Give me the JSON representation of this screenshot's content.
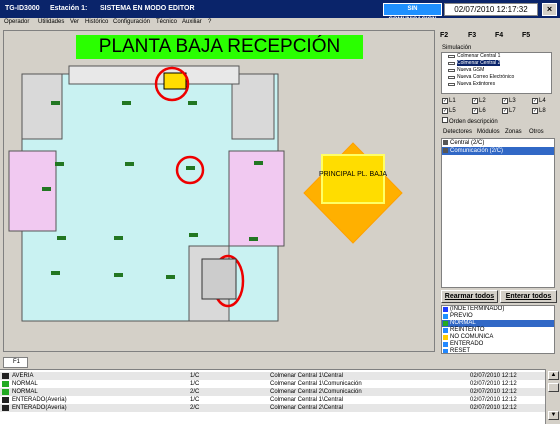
{
  "titlebar": {
    "app": "TG-ID3000",
    "station": "Estación 1:",
    "mode": "SISTEMA EN MODO EDITOR",
    "status": "SIN COMUNICACIÓN",
    "clock": "02/07/2010 12:17:32",
    "close": "×"
  },
  "menu": [
    "Operador",
    "Utilidades",
    "Ver",
    "Histórico",
    "Configuración",
    "Técnico",
    "Auxiliar",
    "?"
  ],
  "plan": {
    "title": "PLANTA BAJA RECEPCIÓN",
    "principal_label": "PRINCIPAL PL. BAJA"
  },
  "toolbar": {
    "tabs": [
      "F2",
      "F3",
      "F4",
      "F5"
    ]
  },
  "simulation": {
    "label": "Simulación",
    "items": [
      {
        "label": "Colmenar Central 1",
        "selected": false
      },
      {
        "label": "Colmenar Central 2",
        "selected": true
      },
      {
        "label": "Nueva GSM",
        "selected": false
      },
      {
        "label": "Nueva Correo Electrónico",
        "selected": false
      },
      {
        "label": "Nueva Extintores",
        "selected": false
      }
    ]
  },
  "loops": [
    "L1",
    "L2",
    "L3",
    "L4",
    "L5",
    "L6",
    "L7",
    "L8"
  ],
  "orden": "Orden descripción",
  "subtabs": [
    "Detectores",
    "Módulos",
    "Zonas",
    "Otros"
  ],
  "objects": [
    {
      "label": "Central (2/C)",
      "selected": false
    },
    {
      "label": "Comunicación (2/C)",
      "selected": true
    }
  ],
  "buttons": {
    "rearm": "Rearmar todos",
    "enter": "Enterar todos"
  },
  "states": [
    {
      "label": "(INDETERMINADO)",
      "color": "#1e3cff",
      "selected": false
    },
    {
      "label": "PREVIO",
      "color": "#1e90ff",
      "selected": false
    },
    {
      "label": "NORMAL",
      "color": "#22aa22",
      "selected": true
    },
    {
      "label": "REINTENTO",
      "color": "#2288ff",
      "selected": false
    },
    {
      "label": "NO COMUNICA",
      "color": "#ffcc00",
      "selected": false
    },
    {
      "label": "ENTERADO",
      "color": "#2288ff",
      "selected": false
    },
    {
      "label": "RESET",
      "color": "#2288ff",
      "selected": false
    }
  ],
  "bottom_tab": "F1",
  "events": [
    {
      "state": "AVERIA",
      "id": "1/C",
      "location": "Colmenar Central 1\\Central",
      "time": "02/07/2010 12:12",
      "icon": "#222222"
    },
    {
      "state": "NORMAL",
      "id": "1/C",
      "location": "Colmenar Central 1\\Comunicación",
      "time": "02/07/2010 12:12",
      "icon": "#22aa22"
    },
    {
      "state": "NORMAL",
      "id": "2/C",
      "location": "Colmenar Central 2\\Comunicación",
      "time": "02/07/2010 12:12",
      "icon": "#22aa22"
    },
    {
      "state": "ENTERADO(Avería)",
      "id": "1/C",
      "location": "Colmenar Central 1\\Central",
      "time": "02/07/2010 12:12",
      "icon": "#222222"
    },
    {
      "state": "ENTERADO(Avería)",
      "id": "2/C",
      "location": "Colmenar Central 2\\Central",
      "time": "02/07/2010 12:12",
      "icon": "#222222"
    }
  ]
}
